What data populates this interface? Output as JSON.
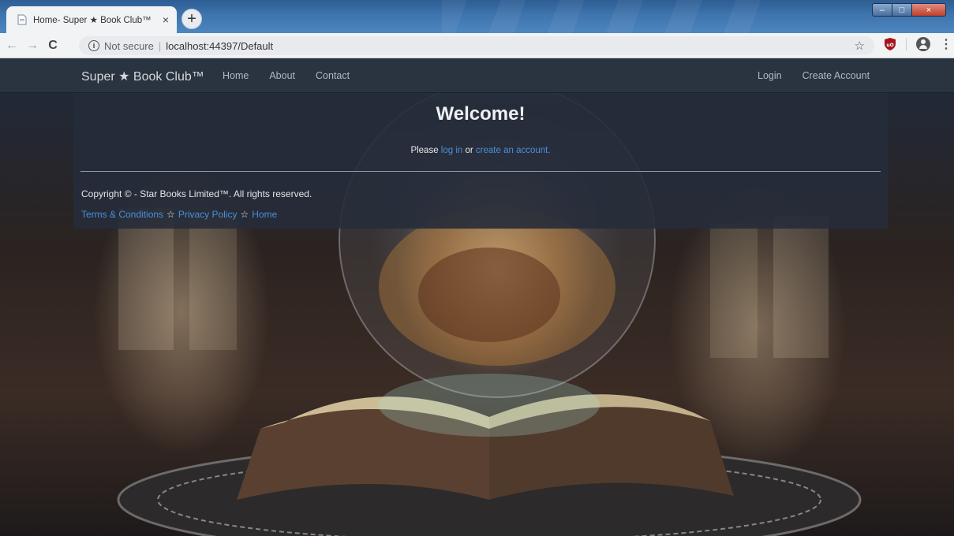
{
  "browser": {
    "tab_title": "Home- Super ★ Book Club™",
    "tab_close": "×",
    "new_tab": "+",
    "nav": {
      "back": "←",
      "forward": "→",
      "reload": "C"
    },
    "security_text": "Not secure",
    "url": "localhost:44397/Default",
    "window_controls": {
      "minimize": "–",
      "maximize": "□",
      "close": "×"
    }
  },
  "site": {
    "brand": "Super ★ Book Club™",
    "nav_links": [
      "Home",
      "About",
      "Contact"
    ],
    "nav_right": [
      "Login",
      "Create Account"
    ]
  },
  "main": {
    "heading": "Welcome!",
    "prompt_prefix": "Please ",
    "login_link": "log in",
    "prompt_middle": " or ",
    "create_link": "create an account."
  },
  "footer": {
    "copyright": "Copyright © - Star Books Limited™. All rights reserved.",
    "links": [
      "Terms & Conditions",
      "Privacy Policy",
      "Home"
    ],
    "separator": "☆"
  },
  "colors": {
    "link": "#4a90d8",
    "navbar_bg": "#2a3340",
    "panel_bg": "#262c3a"
  },
  "icons": [
    "page-favicon",
    "info-icon",
    "bookmark-star-icon",
    "ublock-icon",
    "profile-icon",
    "menu-dots-icon"
  ]
}
